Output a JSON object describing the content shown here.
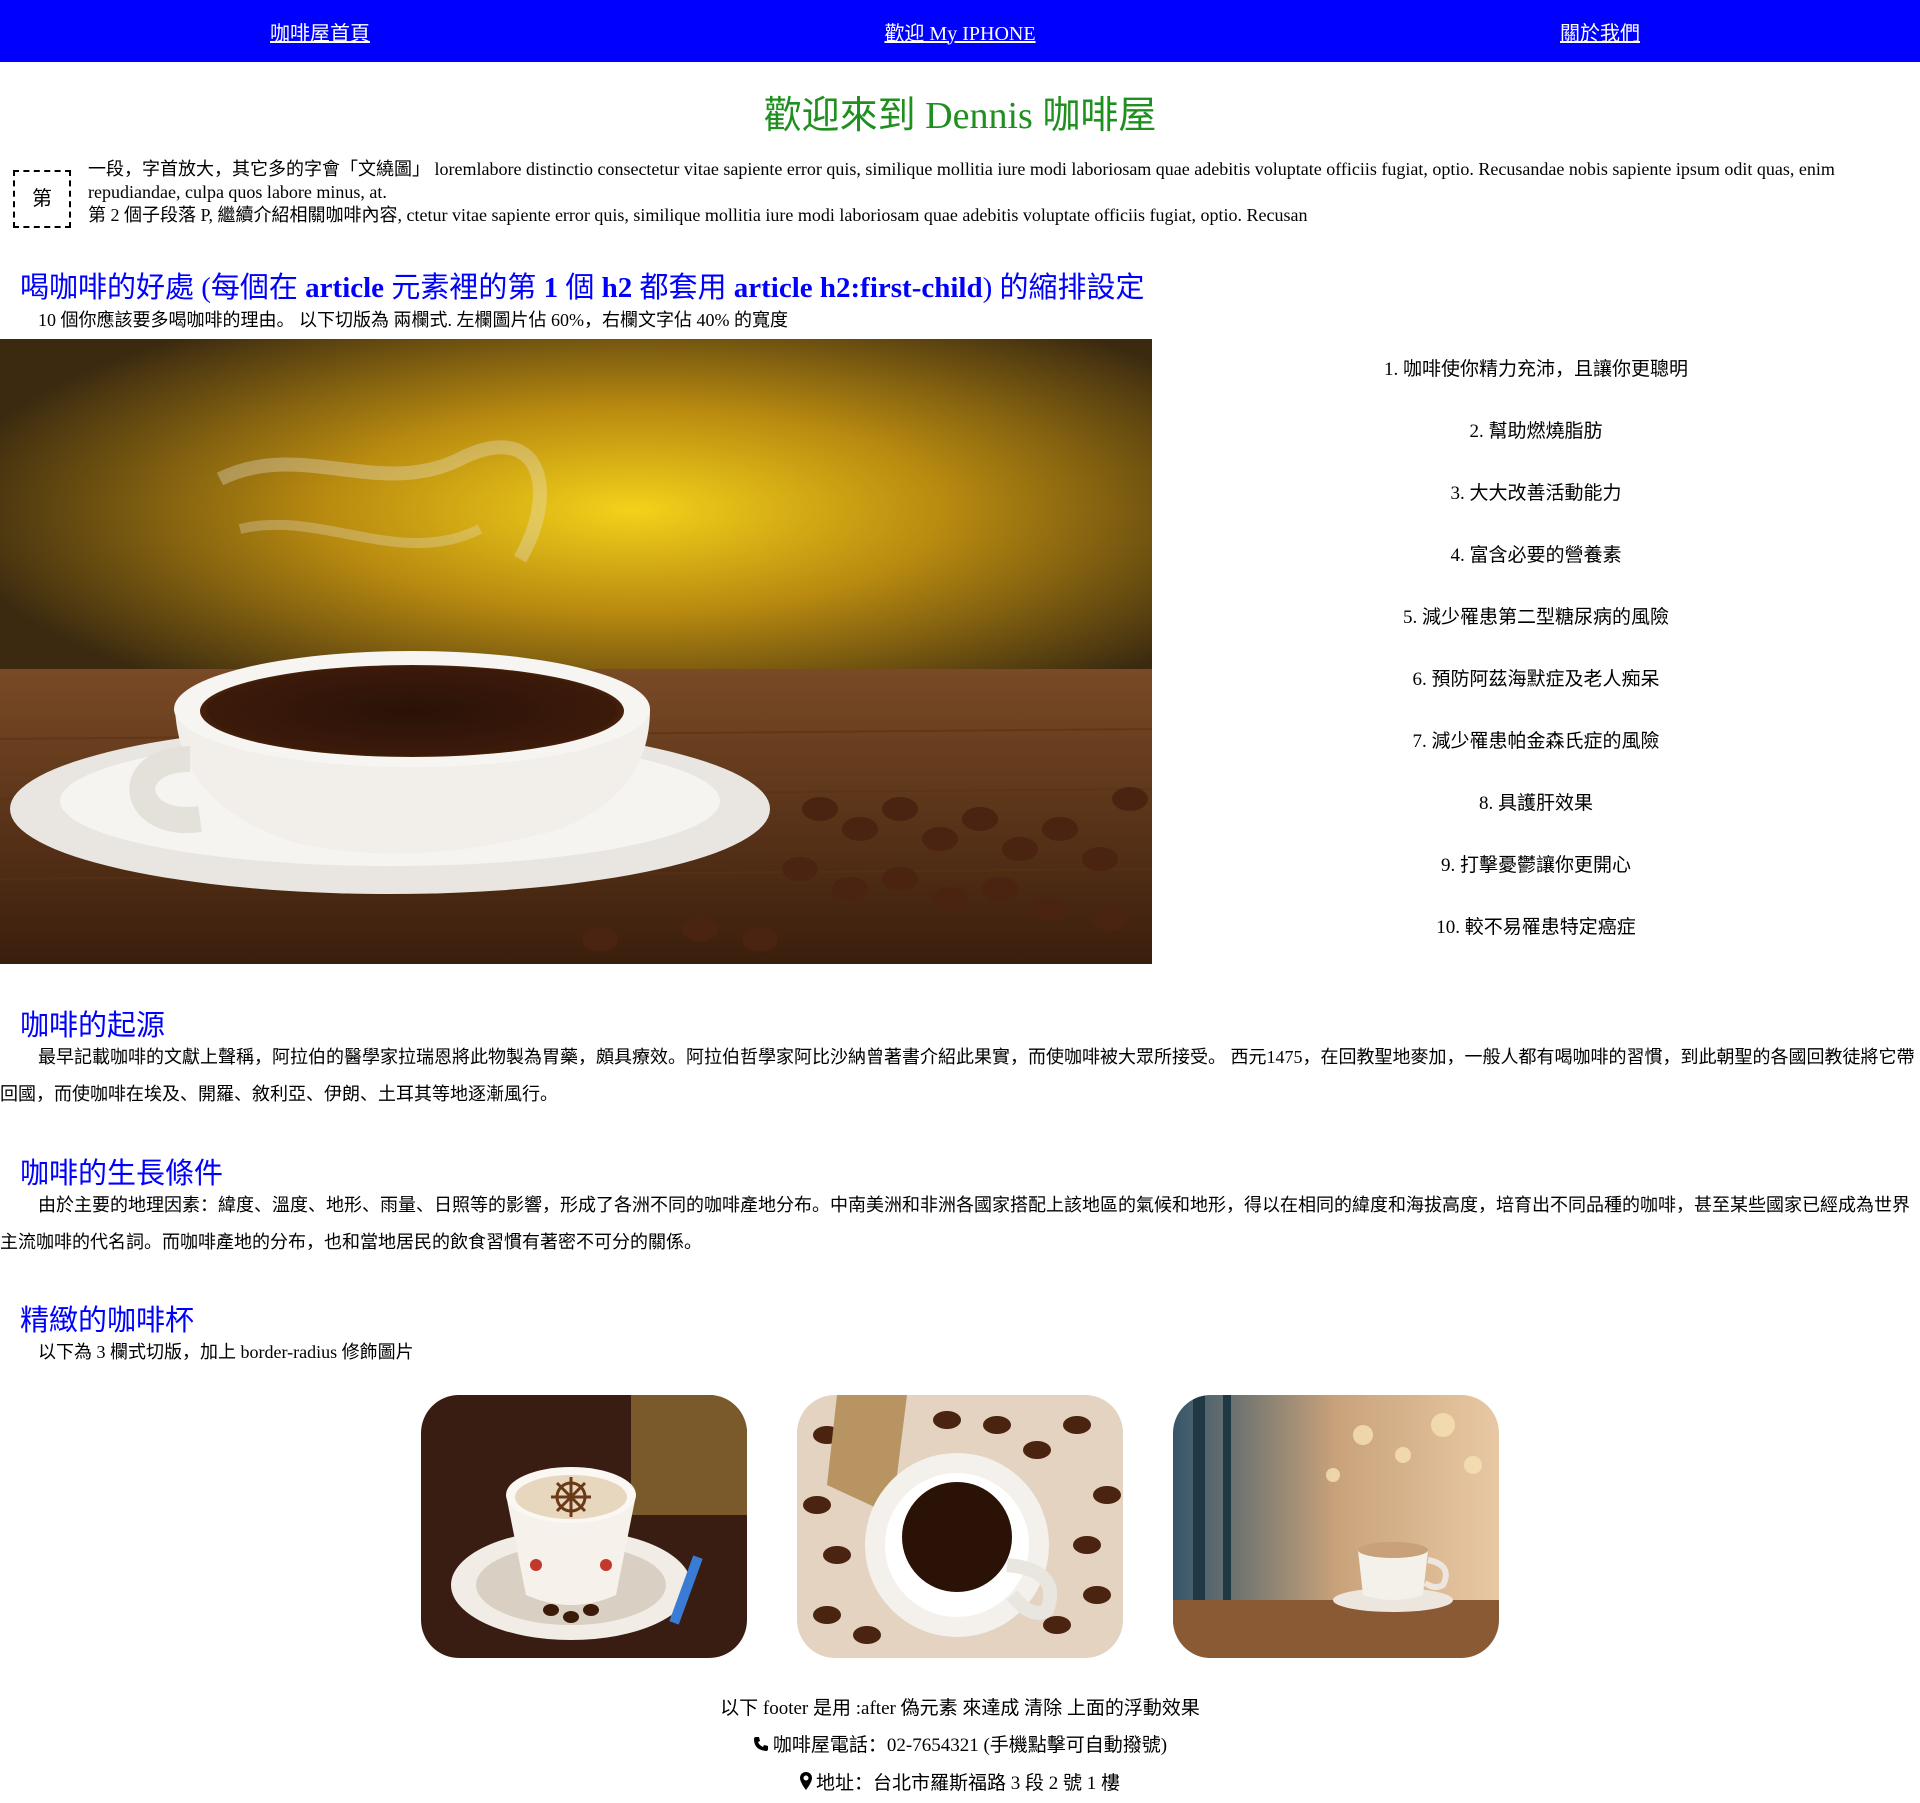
{
  "nav": {
    "items": [
      {
        "label": "咖啡屋首頁"
      },
      {
        "label": "歡迎 My IPHONE"
      },
      {
        "label": "關於我們"
      }
    ]
  },
  "title": "歡迎來到 Dennis 咖啡屋",
  "intro": {
    "dropcap": "第",
    "p1": "一段，字首放大，其它多的字會「文繞圖」 loremlabore distinctio consectetur vitae sapiente error quis, similique mollitia iure modi laboriosam quae adebitis voluptate officiis fugiat, optio. Recusandae nobis sapiente ipsum odit quas, enim repudiandae, culpa quos labore minus, at.",
    "p2": "第 2 個子段落 P, 繼續介紹相關咖啡內容, ctetur vitae sapiente error quis, similique mollitia iure modi laboriosam quae adebitis voluptate officiis fugiat, optio. Recusan"
  },
  "benefits": {
    "heading_a": "喝咖啡的好處 (每個在 ",
    "heading_b": "article",
    "heading_c": " 元素裡的第 ",
    "heading_d": "1",
    "heading_e": " 個 ",
    "heading_f": "h2",
    "heading_g": " 都套用 ",
    "heading_h": "article h2:first-child",
    "heading_i": ") 的縮排設定",
    "intro": "10 個你應該要多喝咖啡的理由。 以下切版為 兩欄式. 左欄圖片佔 60%，右欄文字佔 40% 的寬度",
    "items": [
      "1. 咖啡使你精力充沛，且讓你更聰明",
      "2. 幫助燃燒脂肪",
      "3. 大大改善活動能力",
      "4. 富含必要的營養素",
      "5. 減少罹患第二型糖尿病的風險",
      "6. 預防阿茲海默症及老人痴呆",
      "7. 減少罹患帕金森氏症的風險",
      "8. 具護肝效果",
      "9. 打擊憂鬱讓你更開心",
      "10. 較不易罹患特定癌症"
    ]
  },
  "origin": {
    "heading": "咖啡的起源",
    "text": "最早記載咖啡的文獻上聲稱，阿拉伯的醫學家拉瑞恩將此物製為胃藥，頗具療效。阿拉伯哲學家阿比沙納曾著書介紹此果實，而使咖啡被大眾所接受。 西元1475，在回教聖地麥加，一般人都有喝咖啡的習慣，到此朝聖的各國回教徒將它帶回國，而使咖啡在埃及、開羅、敘利亞、伊朗、土耳其等地逐漸風行。"
  },
  "growth": {
    "heading": "咖啡的生長條件",
    "text": "由於主要的地理因素：緯度、溫度、地形、雨量、日照等的影響，形成了各洲不同的咖啡產地分布。中南美洲和非洲各國家搭配上該地區的氣候和地形，得以在相同的緯度和海拔高度，培育出不同品種的咖啡，甚至某些國家已經成為世界主流咖啡的代名詞。而咖啡產地的分布，也和當地居民的飲食習慣有著密不可分的關係。"
  },
  "cups": {
    "heading": "精緻的咖啡杯",
    "text": "以下為 3 欄式切版，加上 border-radius 修飾圖片"
  },
  "footer": {
    "note": "以下 footer 是用 :after 偽元素 來達成 清除 上面的浮動效果",
    "phone": "咖啡屋電話：02-7654321 (手機點擊可自動撥號)",
    "address": "地址：台北市羅斯福路 3 段 2 號 1 樓",
    "phone_icon": "phone-icon",
    "address_icon": "map-marker-icon"
  },
  "colors": {
    "nav_bg": "#0000ff",
    "title": "#1f8f1f",
    "heading": "#0000ff"
  }
}
